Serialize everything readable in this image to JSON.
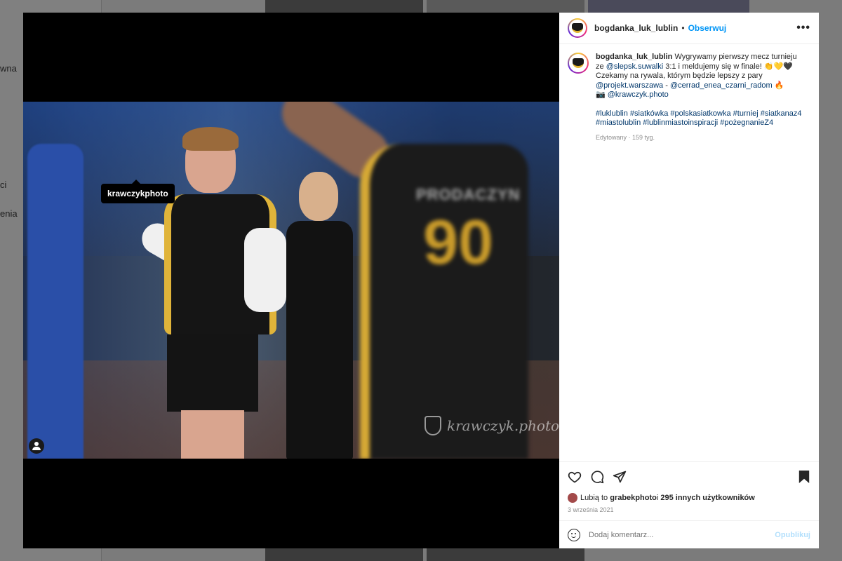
{
  "background": {
    "nav_fragments": [
      "wna",
      "ci",
      "enia"
    ]
  },
  "media": {
    "photo_tag": "krawczykphoto",
    "watermark": "krawczyk.photo",
    "jersey_name": "PRODACZYN",
    "jersey_number": "90"
  },
  "post": {
    "username": "bogdanka_luk_lublin",
    "separator": "•",
    "follow_label": "Obserwuj",
    "more_label": "•••"
  },
  "caption": {
    "username": "bogdanka_luk_lublin",
    "line1": "Wygrywamy pierwszy mecz turnieju ze ",
    "mention1": "@slepsk.suwalki",
    "line2": " 3:1 i meldujemy się w finale! 👏💛🖤",
    "line3": "Czekamy na rywala, którym będzie lepszy z pary",
    "mention2": "@projekt.warszawa",
    "dash": " - ",
    "mention3": "@cerrad_enea_czarni_radom",
    "fire": " 🔥",
    "camera": "📷 ",
    "mention4": "@krawczyk.photo",
    "hashtags1": "#luklublin #siatkówka #polskasiatkowka #turniej #siatkanaz4",
    "hashtags2": "#miastolublin #lublinmiastoinspiracji #pożegnanieZ4",
    "meta": "Edytowany · 159 tyg."
  },
  "likes": {
    "prefix": "Lubią to ",
    "user": "grabekphoto",
    "middle": " i ",
    "others": "295 innych użytkowników"
  },
  "date": "3 września 2021",
  "comment_box": {
    "placeholder": "Dodaj komentarz...",
    "publish_label": "Opublikuj"
  }
}
